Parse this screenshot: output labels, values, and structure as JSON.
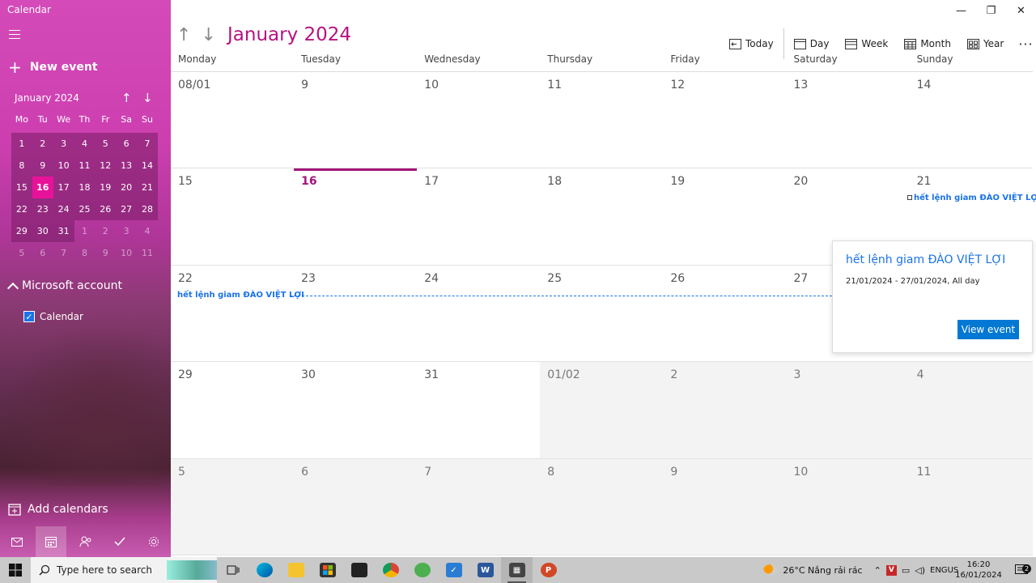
{
  "app": {
    "title": "Calendar"
  },
  "sidebar": {
    "new_event": "New event",
    "mini_month": "January 2024",
    "days_of_week": [
      "Mo",
      "Tu",
      "We",
      "Th",
      "Fr",
      "Sa",
      "Su"
    ],
    "mini_weeks": [
      [
        {
          "d": "1"
        },
        {
          "d": "2"
        },
        {
          "d": "3"
        },
        {
          "d": "4"
        },
        {
          "d": "5"
        },
        {
          "d": "6"
        },
        {
          "d": "7"
        }
      ],
      [
        {
          "d": "8"
        },
        {
          "d": "9"
        },
        {
          "d": "10"
        },
        {
          "d": "11"
        },
        {
          "d": "12"
        },
        {
          "d": "13"
        },
        {
          "d": "14"
        }
      ],
      [
        {
          "d": "15"
        },
        {
          "d": "16",
          "today": true
        },
        {
          "d": "17"
        },
        {
          "d": "18"
        },
        {
          "d": "19"
        },
        {
          "d": "20"
        },
        {
          "d": "21"
        }
      ],
      [
        {
          "d": "22"
        },
        {
          "d": "23"
        },
        {
          "d": "24"
        },
        {
          "d": "25"
        },
        {
          "d": "26"
        },
        {
          "d": "27"
        },
        {
          "d": "28"
        }
      ],
      [
        {
          "d": "29"
        },
        {
          "d": "30"
        },
        {
          "d": "31"
        },
        {
          "d": "1",
          "other": true
        },
        {
          "d": "2",
          "other": true
        },
        {
          "d": "3",
          "other": true
        },
        {
          "d": "4",
          "other": true
        }
      ],
      [
        {
          "d": "5",
          "other": true
        },
        {
          "d": "6",
          "other": true
        },
        {
          "d": "7",
          "other": true
        },
        {
          "d": "8",
          "other": true
        },
        {
          "d": "9",
          "other": true
        },
        {
          "d": "10",
          "other": true
        },
        {
          "d": "11",
          "other": true
        }
      ]
    ],
    "account": "Microsoft account",
    "calendar_label": "Calendar",
    "add_calendars": "Add calendars"
  },
  "header": {
    "month_title": "January 2024",
    "today": "Today",
    "day": "Day",
    "week": "Week",
    "month": "Month",
    "year": "Year",
    "more": "···"
  },
  "grid": {
    "days": [
      "Monday",
      "Tuesday",
      "Wednesday",
      "Thursday",
      "Friday",
      "Saturday",
      "Sunday"
    ],
    "weeks": [
      [
        {
          "n": "08/01"
        },
        {
          "n": "9"
        },
        {
          "n": "10"
        },
        {
          "n": "11"
        },
        {
          "n": "12"
        },
        {
          "n": "13"
        },
        {
          "n": "14"
        }
      ],
      [
        {
          "n": "15"
        },
        {
          "n": "16",
          "today": true
        },
        {
          "n": "17"
        },
        {
          "n": "18"
        },
        {
          "n": "19"
        },
        {
          "n": "20"
        },
        {
          "n": "21"
        }
      ],
      [
        {
          "n": "22"
        },
        {
          "n": "23"
        },
        {
          "n": "24"
        },
        {
          "n": "25"
        },
        {
          "n": "26"
        },
        {
          "n": "27"
        },
        {
          "n": "28"
        }
      ],
      [
        {
          "n": "29"
        },
        {
          "n": "30"
        },
        {
          "n": "31"
        },
        {
          "n": "01/02",
          "other": true
        },
        {
          "n": "2",
          "other": true
        },
        {
          "n": "3",
          "other": true
        },
        {
          "n": "4",
          "other": true
        }
      ],
      [
        {
          "n": "5",
          "other": true
        },
        {
          "n": "6",
          "other": true
        },
        {
          "n": "7",
          "other": true
        },
        {
          "n": "8",
          "other": true
        },
        {
          "n": "9",
          "other": true
        },
        {
          "n": "10",
          "other": true
        },
        {
          "n": "11",
          "other": true
        }
      ]
    ],
    "event_title": "hết lệnh giam ĐÀO VIỆT LỢI"
  },
  "popup": {
    "title": "hết lệnh giam ĐÀO VIỆT LỢI",
    "date": "21/01/2024 - 27/01/2024, All day",
    "button": "View event"
  },
  "taskbar": {
    "search_placeholder": "Type here to search",
    "weather": "26°C  Nắng rải rác",
    "lang_top": "ENG",
    "lang_bottom": "US",
    "time": "16:20",
    "date": "16/01/2024",
    "notif_count": "2"
  },
  "colors": {
    "accent": "#b7127f",
    "today_bar": "#a3157a",
    "event": "#1a73e8",
    "button": "#0078d4"
  }
}
